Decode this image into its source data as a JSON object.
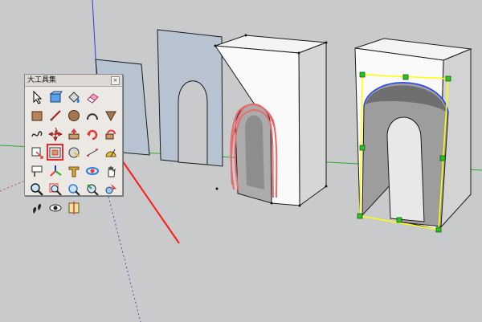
{
  "palette": {
    "title": "大工具集",
    "close_label": "×",
    "selected_tool": "offset",
    "tools": [
      {
        "name": "select"
      },
      {
        "name": "make-component"
      },
      {
        "name": "paint-bucket"
      },
      {
        "name": "eraser"
      },
      {
        "name": "empty"
      },
      {
        "name": "rectangle"
      },
      {
        "name": "line"
      },
      {
        "name": "circle"
      },
      {
        "name": "arc"
      },
      {
        "name": "polygon"
      },
      {
        "name": "freehand"
      },
      {
        "name": "move"
      },
      {
        "name": "push-pull"
      },
      {
        "name": "rotate"
      },
      {
        "name": "follow-me"
      },
      {
        "name": "scale"
      },
      {
        "name": "offset"
      },
      {
        "name": "tape-measure"
      },
      {
        "name": "dimension"
      },
      {
        "name": "protractor"
      },
      {
        "name": "text"
      },
      {
        "name": "axes"
      },
      {
        "name": "3d-text"
      },
      {
        "name": "orbit"
      },
      {
        "name": "pan"
      },
      {
        "name": "zoom"
      },
      {
        "name": "zoom-window"
      },
      {
        "name": "zoom-extents"
      },
      {
        "name": "previous"
      },
      {
        "name": "position-camera"
      },
      {
        "name": "walk"
      },
      {
        "name": "look-around"
      },
      {
        "name": "section-plane"
      }
    ]
  },
  "colors": {
    "background": "#c9cacb",
    "selection_highlight": "#e52b2b",
    "annotation_arrow": "#ff1a1a",
    "selection_box": "#ffff00",
    "grip_handle": "#27c41e",
    "arch_curve": "#1e3cff",
    "sketch_curve": "#e86b6b"
  }
}
